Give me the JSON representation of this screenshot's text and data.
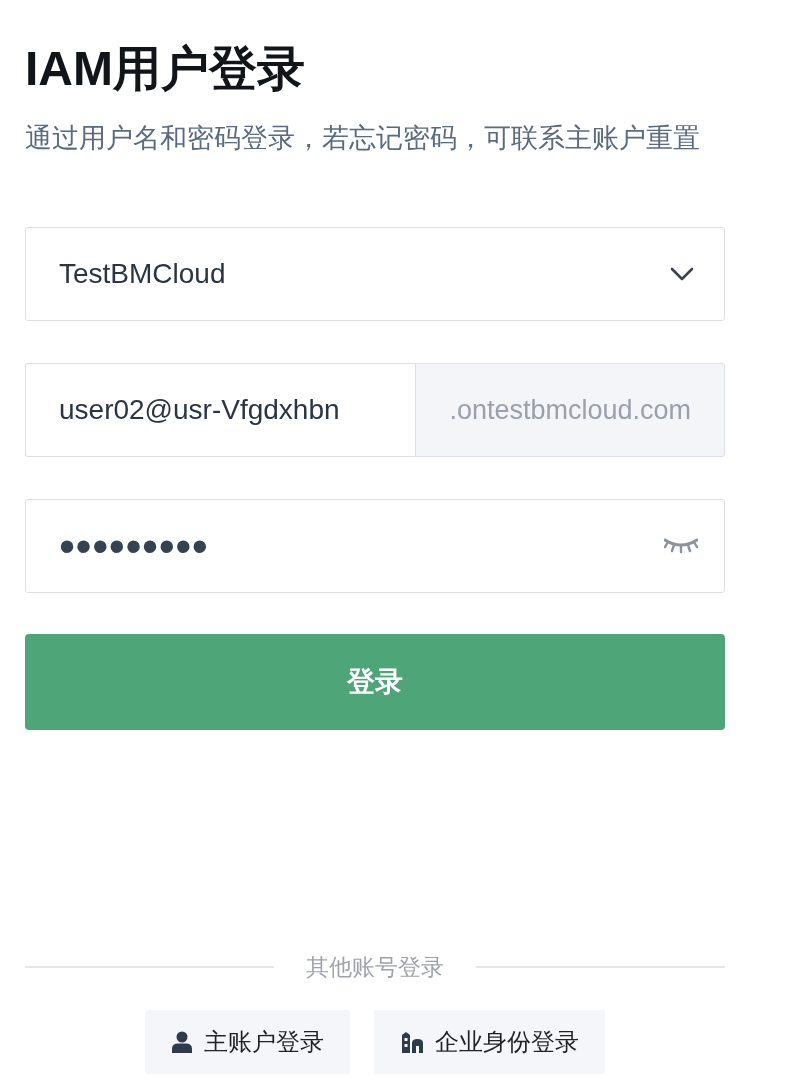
{
  "page": {
    "title": "IAM用户登录",
    "subtitle": "通过用户名和密码登录，若忘记密码，可联系主账户重置"
  },
  "form": {
    "account": {
      "value": "TestBMCloud"
    },
    "username": {
      "value": "user02@usr-Vfgdxhbn",
      "suffix": ".ontestbmcloud.com"
    },
    "password": {
      "value": "•••••••••",
      "visible": false
    },
    "submit": "登录"
  },
  "other_login": {
    "heading": "其他账号登录",
    "options": [
      {
        "label": "主账户登录",
        "kind": "user"
      },
      {
        "label": "企业身份登录",
        "kind": "enterprise"
      }
    ]
  }
}
